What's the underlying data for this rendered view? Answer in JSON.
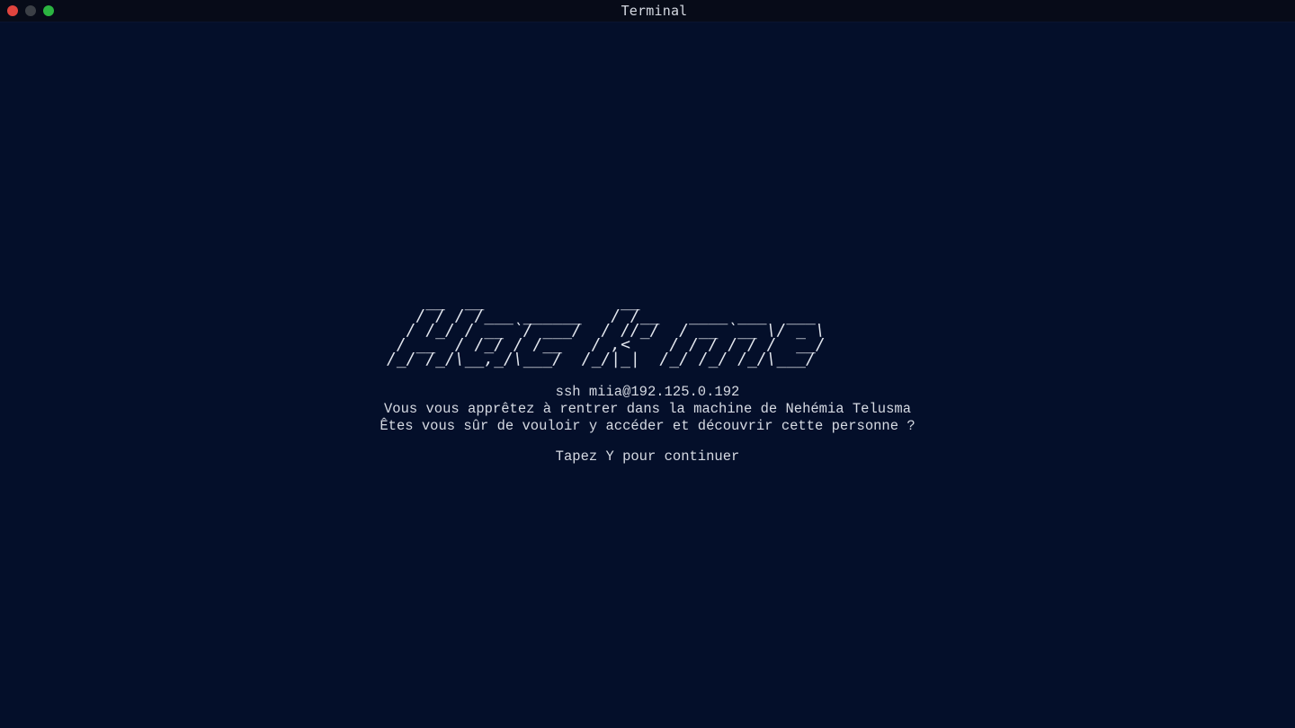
{
  "window": {
    "title": "Terminal"
  },
  "terminal": {
    "banner": "    __  __              __                       \n   / / / /___ ______   / /__   ____ ___  ___     \n  / /_/ / __ `/ ___/  / //_/  / __ `__ \\/ _ \\    \n / __  / /_/ / /__   / ,<    / / / / / /  __/    \n/_/ /_/\\__,_/\\___/  /_/|_|  /_/ /_/ /_/\\___/     ",
    "command": "ssh miia@192.125.0.192",
    "line1": "Vous vous apprêtez à rentrer dans la machine de Nehémia Telusma",
    "line2": "Êtes vous sûr de vouloir y accéder et découvrir cette personne ?",
    "prompt": "Tapez Y pour continuer"
  },
  "colors": {
    "background": "#040f2a",
    "text": "#d6dae3",
    "close": "#e0443e",
    "minimize": "#3b3f46",
    "maximize": "#2bb441"
  }
}
